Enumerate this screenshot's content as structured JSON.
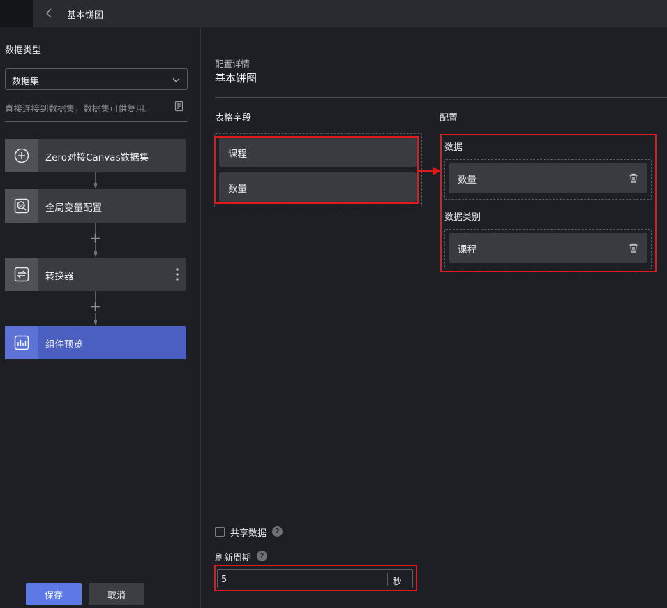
{
  "header": {
    "title": "基本饼图"
  },
  "left_panel": {
    "data_type_label": "数据类型",
    "data_type_value": "数据集",
    "hint": "直接连接到数据集，数据集可供复用。",
    "nodes": [
      {
        "label": "Zero对接Canvas数据集",
        "icon": "plus-circle-icon"
      },
      {
        "label": "全局变量配置",
        "icon": "global-variable-icon"
      },
      {
        "label": "转换器",
        "icon": "transform-icon"
      },
      {
        "label": "组件预览",
        "icon": "chart-preview-icon"
      }
    ],
    "save_label": "保存",
    "cancel_label": "取消"
  },
  "main": {
    "config_detail_label": "配置详情",
    "config_detail_value": "基本饼图",
    "fields_header": "表格字段",
    "config_header": "配置",
    "fields": [
      "课程",
      "数量"
    ],
    "config": {
      "data_label": "数据",
      "data_value": "数量",
      "category_label": "数据类别",
      "category_value": "课程"
    },
    "share_label": "共享数据",
    "refresh_label": "刷新周期",
    "refresh_value": "5",
    "refresh_unit": "秒"
  },
  "colors": {
    "accent": "#4b5fc0",
    "save_button": "#5d79e6",
    "highlight": "#e0191c"
  }
}
